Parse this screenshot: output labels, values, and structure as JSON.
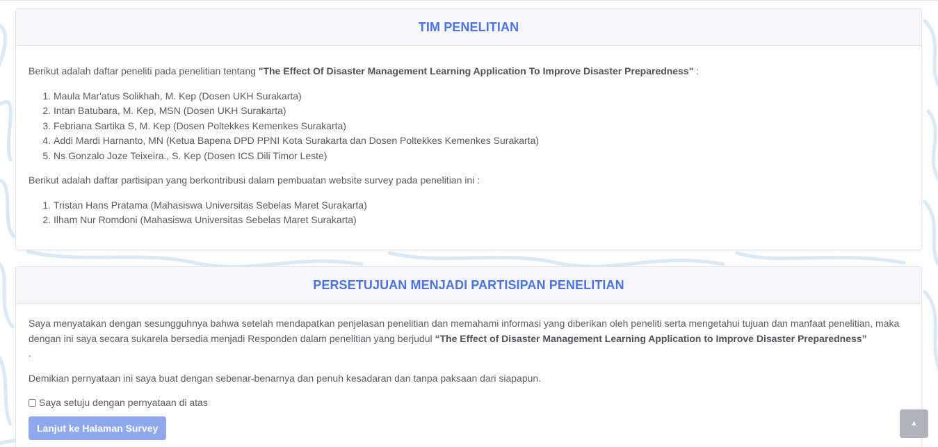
{
  "team_card": {
    "title": "TIM PENELITIAN",
    "intro_text": "Berikut adalah daftar peneliti pada penelitian tentang ",
    "study_title": "\"The Effect Of Disaster Management Learning Application To Improve Disaster Preparedness\"",
    "intro_suffix": " :",
    "researchers": [
      "Maula Mar'atus Solikhah, M. Kep (Dosen UKH Surakarta)",
      "Intan Batubara, M. Kep, MSN (Dosen UKH Surakarta)",
      "Febriana Sartika S, M. Kep (Dosen Poltekkes Kemenkes Surakarta)",
      "Addi Mardi Harnanto, MN (Ketua Bapena DPD PPNI Kota Surakarta dan Dosen Poltekkes Kemenkes Surakarta)",
      "Ns Gonzalo Joze Teixeira., S. Kep (Dosen ICS Dili Timor Leste)"
    ],
    "participants_intro": "Berikut adalah daftar partisipan yang berkontribusi dalam pembuatan website survey pada penelitian ini :",
    "participants": [
      "Tristan Hans Pratama (Mahasiswa Universitas Sebelas Maret Surakarta)",
      "Ilham Nur Romdoni (Mahasiswa Universitas Sebelas Maret Surakarta)"
    ]
  },
  "consent_card": {
    "title": "PERSETUJUAN MENJADI PARTISIPAN PENELITIAN",
    "statement_text": "Saya menyatakan dengan sesungguhnya bahwa setelah mendapatkan penjelasan penelitian dan memahami informasi yang diberikan oleh peneliti serta mengetahui tujuan dan manfaat penelitian, maka dengan ini saya secara sukarela bersedia menjadi Responden dalam penelitian yang berjudul ",
    "study_title": "“The Effect of Disaster Management Learning Application to Improve Disaster Preparedness”",
    "statement_end": ".",
    "declaration": "Demikian pernyataan ini saya buat dengan sebenar-benarnya dan penuh kesadaran dan tanpa paksaan dari siapapun.",
    "agree_label": "Saya setuju dengan pernyataan di atas",
    "agree_checked": false,
    "continue_button": "Lanjut ke Halaman Survey"
  },
  "scroll_top": {
    "icon": "chevron-up-icon",
    "glyph": "▲"
  },
  "colors": {
    "accent": "#4e73df",
    "button_disabled": "#8fa8ee",
    "header_bg": "#f6f7fb",
    "scroll_button": "#aeb3bb",
    "pattern": "#dbe9f5"
  }
}
